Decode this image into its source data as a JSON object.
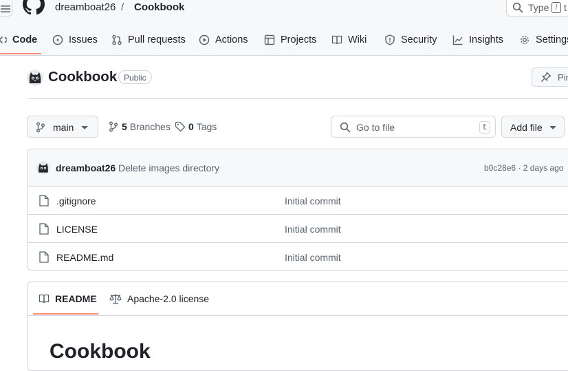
{
  "header": {
    "owner": "dreamboat26",
    "separator": "/",
    "repo": "Cookbook",
    "search_label": "Type",
    "search_key": "/",
    "search_tail": "t"
  },
  "nav": {
    "tabs": [
      {
        "label": "Code",
        "icon": "code-icon",
        "active": true
      },
      {
        "label": "Issues",
        "icon": "issue-icon"
      },
      {
        "label": "Pull requests",
        "icon": "pull-request-icon"
      },
      {
        "label": "Actions",
        "icon": "play-icon"
      },
      {
        "label": "Projects",
        "icon": "table-icon"
      },
      {
        "label": "Wiki",
        "icon": "book-icon"
      },
      {
        "label": "Security",
        "icon": "shield-icon"
      },
      {
        "label": "Insights",
        "icon": "graph-icon"
      },
      {
        "label": "Settings",
        "icon": "gear-icon"
      }
    ],
    "accent": "#fd8c73"
  },
  "repo": {
    "name": "Cookbook",
    "visibility": "Public",
    "pin_label": "Pin"
  },
  "branch_bar": {
    "branch": "main",
    "branches_count": "5",
    "branches_label": "Branches",
    "tags_count": "0",
    "tags_label": "Tags",
    "goto_placeholder": "Go to file",
    "goto_key": "t",
    "add_file_label": "Add file"
  },
  "commit": {
    "author": "dreamboat26",
    "message": "Delete images directory",
    "meta": "b0c28e6 · 2 days ago"
  },
  "files": [
    {
      "name": ".gitignore",
      "message": "Initial commit"
    },
    {
      "name": "LICENSE",
      "message": "Initial commit"
    },
    {
      "name": "README.md",
      "message": "Initial commit"
    }
  ],
  "readme": {
    "tab_readme": "README",
    "tab_license": "Apache-2.0 license",
    "heading": "Cookbook"
  }
}
